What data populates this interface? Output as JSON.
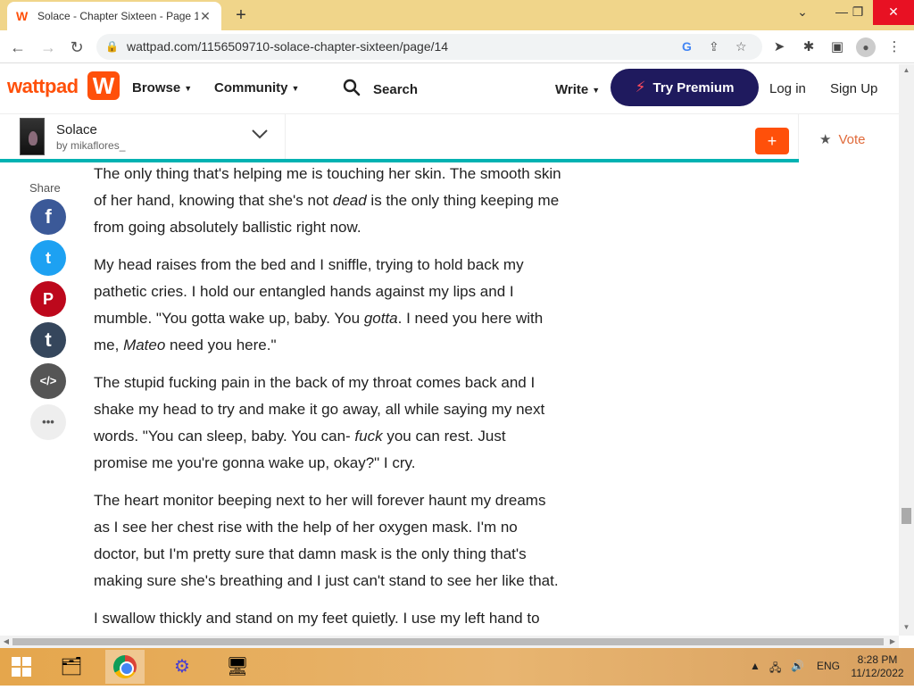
{
  "browser": {
    "tab_title": "Solace - Chapter Sixteen - Page 1",
    "url": "wattpad.com/1156509710-solace-chapter-sixteen/page/14"
  },
  "header": {
    "logo": "wattpad",
    "logo_mark": "W",
    "browse": "Browse",
    "community": "Community",
    "search": "Search",
    "write": "Write",
    "premium": "Try Premium",
    "login": "Log in",
    "signup": "Sign Up"
  },
  "story": {
    "title": "Solace",
    "author": "by mikaflores_",
    "add_label": "+",
    "vote_label": "Vote",
    "cover_title": "Solace"
  },
  "share": {
    "label": "Share",
    "buttons": [
      {
        "name": "facebook",
        "glyph": "f",
        "color": "#3b5998"
      },
      {
        "name": "twitter",
        "glyph": "t",
        "color": "#1da1f2"
      },
      {
        "name": "pinterest",
        "glyph": "P",
        "color": "#bd081c"
      },
      {
        "name": "tumblr",
        "glyph": "t",
        "color": "#35465c"
      },
      {
        "name": "embed",
        "glyph": "</>",
        "color": "#555555"
      },
      {
        "name": "more",
        "glyph": "•••",
        "color": "#eeeeee"
      }
    ]
  },
  "content": {
    "p1a": "The only thing that's helping me is touching her skin. The smooth skin of her hand, knowing that she's not ",
    "p1b": "dead",
    "p1c": " is the only thing keeping me from going absolutely ballistic right now.",
    "p2a": "My head raises from the bed and I sniffle, trying to hold back my pathetic cries. I hold our entangled hands against my lips and I mumble. \"You gotta wake up, baby. You ",
    "p2b": "gotta",
    "p2c": ". I need you here with me, ",
    "p2d": "Mateo",
    "p2e": " need you here.\"",
    "p3a": "The stupid fucking pain in the back of my throat comes back and I shake my head to try and make it go away, all while saying my next words. \"You can sleep, baby. You can- ",
    "p3b": "fuck",
    "p3c": " you can rest. Just promise me you're gonna wake up, okay?\" I cry.",
    "p4": "The heart monitor beeping next to her will forever haunt my dreams as I see her chest rise with the help of her oxygen mask. I'm no doctor, but I'm pretty sure that damn mask is the only thing that's making sure she's breathing and I just can't stand to see her like that.",
    "p5": "I swallow thickly and stand on my feet quietly. I use my left hand to"
  },
  "taskbar": {
    "lang": "ENG",
    "time": "8:28 PM",
    "date": "11/12/2022"
  },
  "colors": {
    "brand": "#ff500a",
    "premium_bg": "#1f1a5e",
    "progress": "#00b2b2"
  }
}
